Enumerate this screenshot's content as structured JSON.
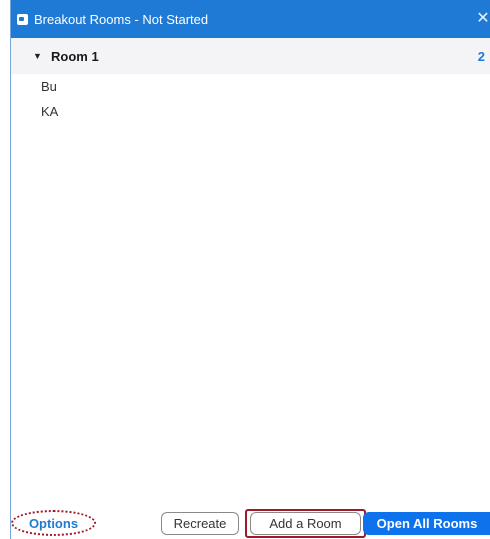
{
  "window": {
    "title": "Breakout Rooms - Not Started",
    "close_glyph": "✕"
  },
  "room": {
    "caret_glyph": "▼",
    "name": "Room 1",
    "count": "2",
    "participants": [
      "Bu",
      "KA"
    ]
  },
  "footer": {
    "options_label": "Options",
    "recreate_label": "Recreate",
    "add_room_label": "Add a Room",
    "open_all_label": "Open All Rooms"
  },
  "colors": {
    "accent": "#1f7ad6",
    "primary_button": "#0e72ed",
    "highlight": "#9e1a2a"
  },
  "icons": {
    "app": "zoom-camera-icon",
    "close": "close-icon",
    "caret": "caret-down-icon"
  }
}
